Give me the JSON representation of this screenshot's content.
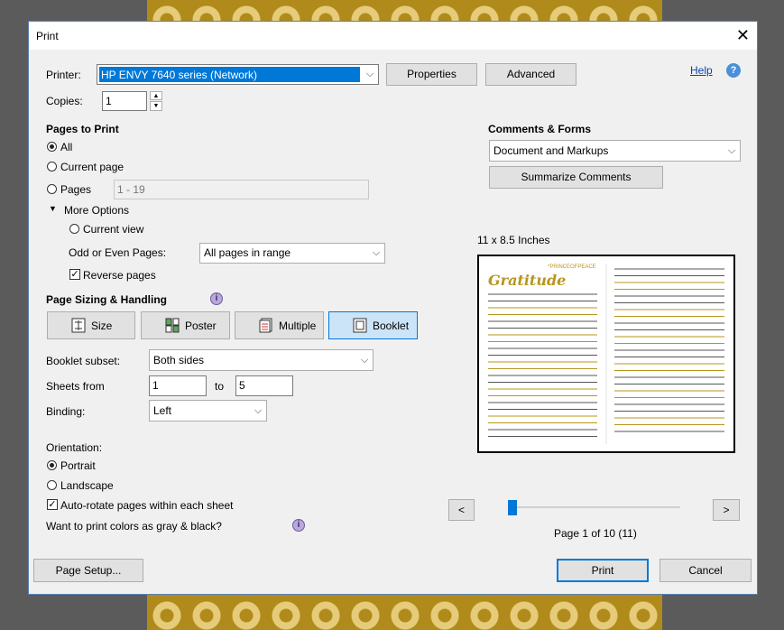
{
  "window": {
    "title": "Print"
  },
  "printer": {
    "label": "Printer:",
    "selected": "HP ENVY 7640 series (Network)",
    "properties_label": "Properties",
    "advanced_label": "Advanced",
    "help_label": "Help"
  },
  "copies": {
    "label": "Copies:",
    "value": "1"
  },
  "pages_to_print": {
    "heading": "Pages to Print",
    "all_label": "All",
    "current_page_label": "Current page",
    "pages_label": "Pages",
    "pages_value": "1 - 19",
    "more_options_label": "More Options",
    "current_view_label": "Current view",
    "odd_even_label": "Odd or Even Pages:",
    "odd_even_value": "All pages in range",
    "reverse_pages_label": "Reverse pages"
  },
  "page_sizing": {
    "heading": "Page Sizing & Handling",
    "size_label": "Size",
    "poster_label": "Poster",
    "multiple_label": "Multiple",
    "booklet_label": "Booklet",
    "booklet_subset_label": "Booklet subset:",
    "booklet_subset_value": "Both sides",
    "sheets_from_label": "Sheets from",
    "sheets_from_value": "1",
    "sheets_to_label": "to",
    "sheets_to_value": "5",
    "binding_label": "Binding:",
    "binding_value": "Left"
  },
  "orientation": {
    "label": "Orientation:",
    "portrait_label": "Portrait",
    "landscape_label": "Landscape",
    "auto_rotate_label": "Auto-rotate pages within each sheet",
    "gray_question": "Want to print colors as gray & black?"
  },
  "comments_forms": {
    "heading": "Comments & Forms",
    "value": "Document and Markups",
    "summarize_label": "Summarize Comments"
  },
  "preview": {
    "size_label": "11 x 8.5 Inches",
    "doc_title": "Gratitude",
    "doc_tag": "*PRINCEOFPEACE",
    "page_info": "Page 1 of 10 (11)",
    "prev_label": "<",
    "next_label": ">"
  },
  "footer": {
    "page_setup_label": "Page Setup...",
    "print_label": "Print",
    "cancel_label": "Cancel"
  }
}
